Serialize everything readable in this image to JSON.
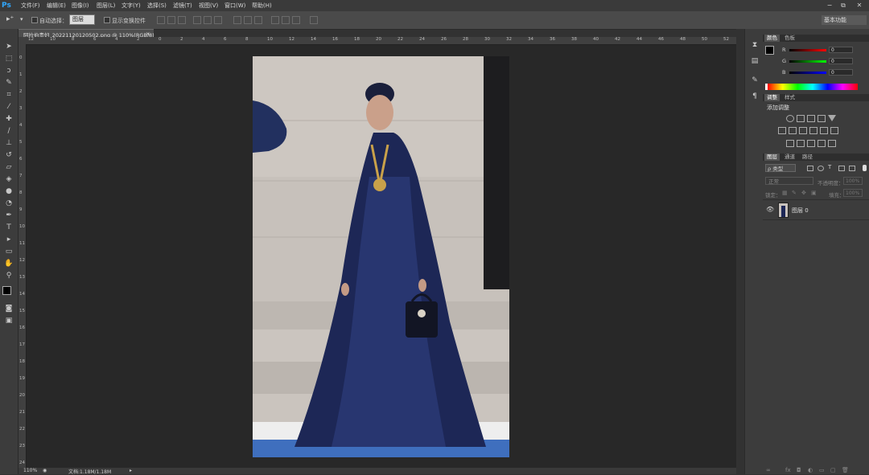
{
  "app": {
    "logo": "Ps"
  },
  "menu": [
    "文件(F)",
    "编辑(E)",
    "图像(I)",
    "图层(L)",
    "文字(Y)",
    "选择(S)",
    "滤镜(T)",
    "视图(V)",
    "窗口(W)",
    "帮助(H)"
  ],
  "window_buttons": [
    "−",
    "⧉",
    "✕"
  ],
  "options": {
    "auto_select_label": "自动选择：",
    "auto_select_value": "图层",
    "show_transform_label": "显示变换控件",
    "workspace": "基本功能"
  },
  "document": {
    "tab_title": "阿拉伯贵妇_20221120120502.png @ 110%(RGB/8)",
    "tab_close": "×",
    "zoom": "110%",
    "doc_info": "文档:1.18M/1.18M"
  },
  "rulers": {
    "h": [
      "12",
      "10",
      "8",
      "6",
      "4",
      "2",
      "0",
      "2",
      "4",
      "6",
      "8",
      "10",
      "12",
      "14",
      "16",
      "18",
      "20",
      "22",
      "24",
      "26",
      "28",
      "30",
      "32",
      "34",
      "36",
      "38",
      "40",
      "42",
      "44",
      "46",
      "48",
      "50",
      "52"
    ],
    "v": [
      "0",
      "1",
      "2",
      "3",
      "4",
      "5",
      "6",
      "7",
      "8",
      "9",
      "10",
      "11",
      "12",
      "13",
      "14",
      "15",
      "16",
      "17",
      "18",
      "19",
      "20",
      "21",
      "22",
      "23",
      "24"
    ]
  },
  "color_panel": {
    "tabs": [
      "颜色",
      "色板"
    ],
    "channels": [
      {
        "label": "R",
        "value": "0"
      },
      {
        "label": "G",
        "value": "0"
      },
      {
        "label": "B",
        "value": "0"
      }
    ]
  },
  "adjust_panel": {
    "tabs": [
      "调整",
      "样式"
    ],
    "title": "添加调整"
  },
  "layers_panel": {
    "tabs": [
      "图层",
      "通道",
      "路径"
    ],
    "kind_label": "ρ 类型",
    "blend_mode": "正常",
    "opacity_label": "不透明度：",
    "opacity_value": "100%",
    "lock_label": "锁定：",
    "fill_label": "填充：",
    "fill_value": "100%",
    "layers": [
      {
        "name": "图层 0"
      }
    ]
  },
  "colors": {
    "accent": "#31a8ff",
    "bg": "#323232",
    "panel": "#3c3c3c"
  }
}
